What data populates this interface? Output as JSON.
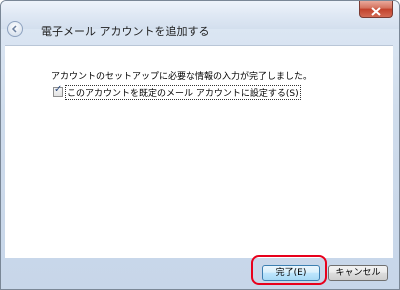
{
  "window": {
    "title": "電子メール アカウントを追加する"
  },
  "content": {
    "message": "アカウントのセットアップに必要な情報の入力が完了しました。",
    "checkbox": {
      "label": "このアカウントを既定のメール アカウントに設定する(S)",
      "checked": true
    }
  },
  "footer": {
    "finish_label": "完了(E)",
    "cancel_label": "キャンセル"
  },
  "annotation": {
    "highlight_color": "#e8001c"
  }
}
